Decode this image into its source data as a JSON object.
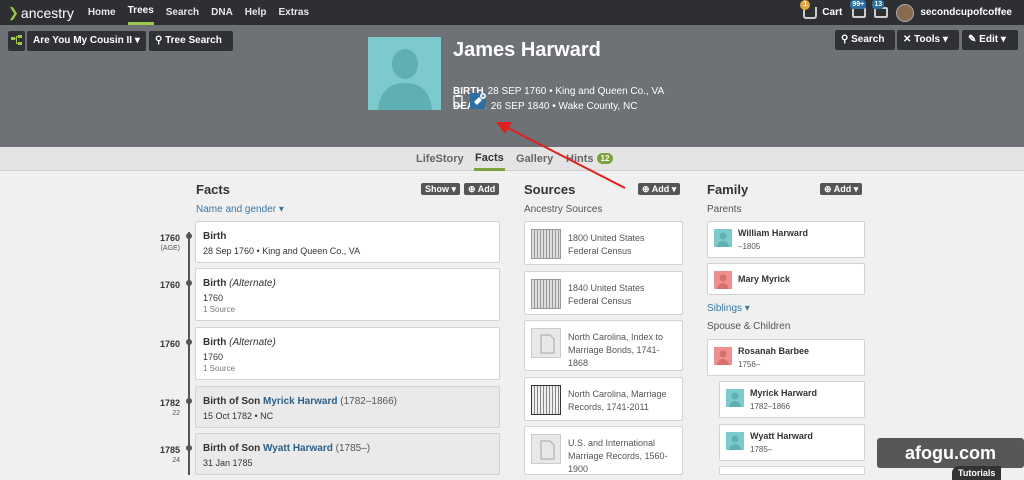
{
  "nav": {
    "logo": "ancestry",
    "items": [
      "Home",
      "Trees",
      "Search",
      "DNA",
      "Help",
      "Extras"
    ],
    "active": "Trees",
    "cart_label": "Cart",
    "cart_badge": "1",
    "msg_badge_1": "99+",
    "msg_badge_2": "13",
    "username": "secondcupofcoffee"
  },
  "toolbar": {
    "tree_name": "Are You My Cousin II",
    "tree_search": "Tree Search",
    "search": "Search",
    "tools": "Tools",
    "edit": "Edit"
  },
  "person": {
    "name": "James Harward",
    "birth_label": "BIRTH",
    "birth": "28 SEP 1760 • King and Queen Co., VA",
    "death_label": "DEATH",
    "death": "26 SEP 1840 • Wake County, NC"
  },
  "tabs": {
    "lifestory": "LifeStory",
    "facts": "Facts",
    "gallery": "Gallery",
    "hints": "Hints",
    "hints_count": "12"
  },
  "facts": {
    "title": "Facts",
    "show": "Show",
    "add": "Add",
    "name_gender": "Name and gender",
    "items": [
      {
        "year": "1760",
        "yearsub": "(AGE)",
        "title": "Birth",
        "alt": "",
        "detail": "28 Sep 1760 • King and Queen Co., VA",
        "source": ""
      },
      {
        "year": "1760",
        "yearsub": "",
        "title": "Birth",
        "alt": "(Alternate)",
        "detail": "1760",
        "source": "1 Source"
      },
      {
        "year": "1760",
        "yearsub": "",
        "title": "Birth",
        "alt": "(Alternate)",
        "detail": "1760",
        "source": "1 Source"
      },
      {
        "year": "1782",
        "yearsub": "22",
        "title": "Birth of Son",
        "child": "Myrick Harward",
        "childyears": "(1782–1866)",
        "detail": "15 Oct 1782 • NC"
      },
      {
        "year": "1785",
        "yearsub": "24",
        "title": "Birth of Son",
        "child": "Wyatt Harward",
        "childyears": "(1785–)",
        "detail": "31 Jan 1785"
      }
    ]
  },
  "sources": {
    "title": "Sources",
    "add": "Add",
    "sub": "Ancestry Sources",
    "items": [
      {
        "l1": "1800 United States",
        "l2": "Federal Census",
        "l3": ""
      },
      {
        "l1": "1840 United States",
        "l2": "Federal Census",
        "l3": ""
      },
      {
        "l1": "North Carolina, Index to",
        "l2": "Marriage Bonds, 1741-",
        "l3": "1868"
      },
      {
        "l1": "North Carolina, Marriage",
        "l2": "Records, 1741-2011",
        "l3": ""
      },
      {
        "l1": "U.S. and International",
        "l2": "Marriage Records, 1560-",
        "l3": "1900"
      }
    ]
  },
  "family": {
    "title": "Family",
    "add": "Add",
    "parents_label": "Parents",
    "siblings": "Siblings",
    "spouse_label": "Spouse & Children",
    "father": {
      "name": "William Harward",
      "dates": "–1805"
    },
    "mother": {
      "name": "Mary Myrick",
      "dates": ""
    },
    "spouse": {
      "name": "Rosanah Barbee",
      "dates": "1756–"
    },
    "children": [
      {
        "name": "Myrick Harward",
        "dates": "1782–1866"
      },
      {
        "name": "Wyatt Harward",
        "dates": "1785–"
      }
    ]
  },
  "overlay": {
    "watermark": "afogu.com",
    "tutorials": "Tutorials"
  },
  "colors": {
    "accent_green": "#7aa33e",
    "male_avatar": "#7ccacb",
    "female_avatar": "#ef8f8f",
    "arrow": "#e0201e"
  }
}
